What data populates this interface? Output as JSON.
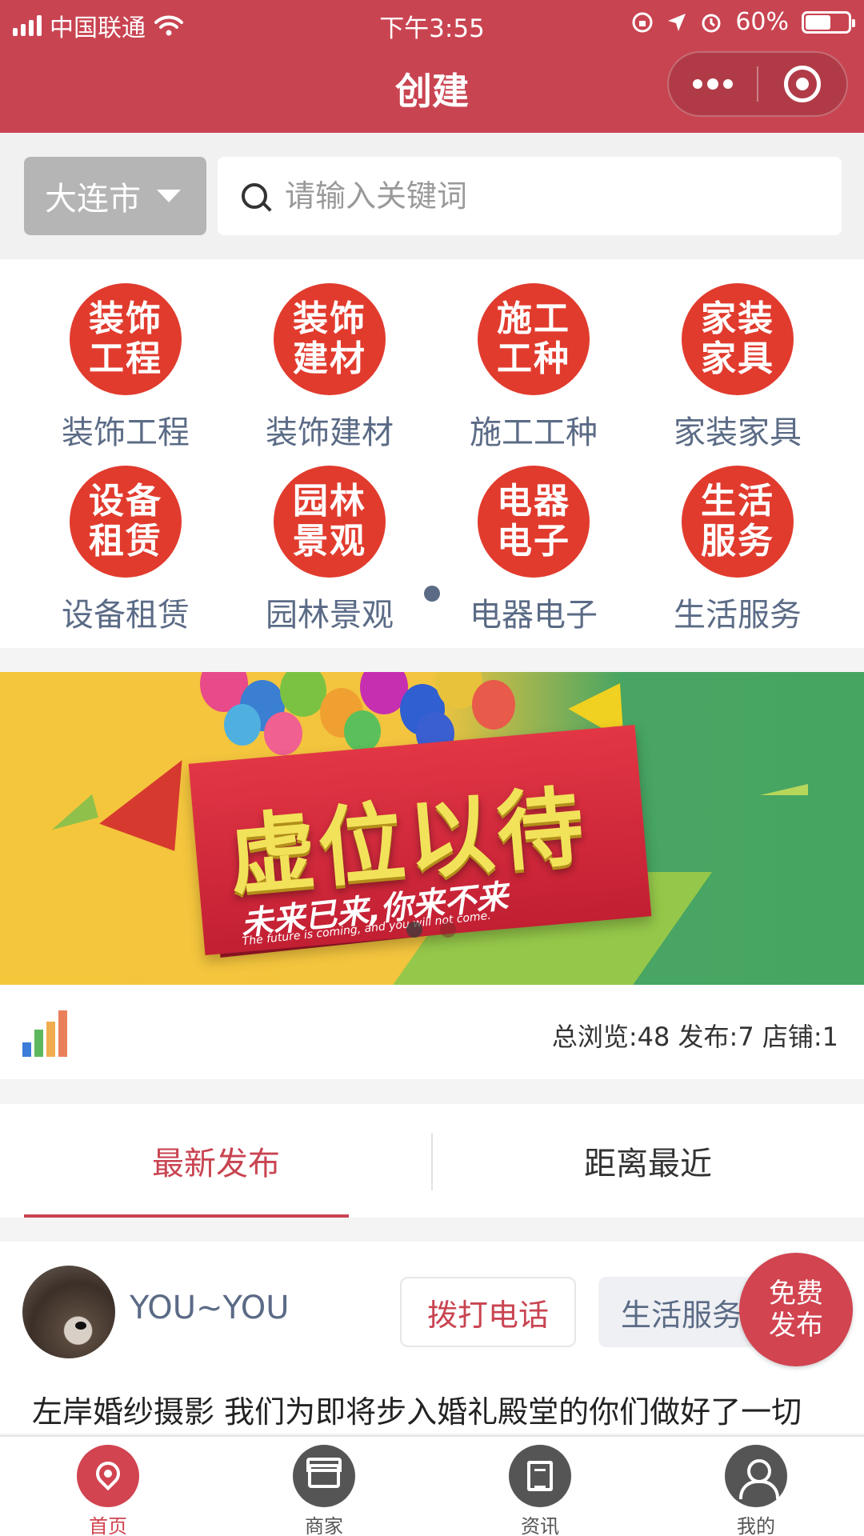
{
  "status_bar": {
    "carrier": "中国联通",
    "time": "下午3:55",
    "battery": "60%",
    "battery_level": 0.6
  },
  "nav": {
    "title": "创建"
  },
  "search": {
    "city": "大连市",
    "placeholder": "请输入关键词"
  },
  "categories": [
    {
      "badge_line1": "装饰",
      "badge_line2": "工程",
      "label": "装饰工程"
    },
    {
      "badge_line1": "装饰",
      "badge_line2": "建材",
      "label": "装饰建材"
    },
    {
      "badge_line1": "施工",
      "badge_line2": "工种",
      "label": "施工工种"
    },
    {
      "badge_line1": "家装",
      "badge_line2": "家具",
      "label": "家装家具"
    },
    {
      "badge_line1": "设备",
      "badge_line2": "租赁",
      "label": "设备租赁"
    },
    {
      "badge_line1": "园林",
      "badge_line2": "景观",
      "label": "园林景观"
    },
    {
      "badge_line1": "电器",
      "badge_line2": "电子",
      "label": "电器电子"
    },
    {
      "badge_line1": "生活",
      "badge_line2": "服务",
      "label": "生活服务"
    }
  ],
  "banner": {
    "headline": "虚位以待",
    "slogan": "未来已来,你来不来",
    "subtext": "The future is coming, and you will not come."
  },
  "stats": {
    "text": "总浏览:48 发布:7 店铺:1"
  },
  "tabs": [
    {
      "label": "最新发布",
      "active": true
    },
    {
      "label": "距离最近",
      "active": false
    }
  ],
  "post": {
    "username": "YOU~YOU",
    "call_label": "拨打电话",
    "category": "生活服务",
    "description": "左岸婚纱摄影 我们为即将步入婚礼殿堂的你们做好了一切"
  },
  "fab": {
    "line1": "免费",
    "line2": "发布"
  },
  "tabbar": [
    {
      "label": "首页",
      "icon": "location-pin-icon",
      "active": true
    },
    {
      "label": "商家",
      "icon": "shop-icon",
      "active": false
    },
    {
      "label": "资讯",
      "icon": "news-icon",
      "active": false
    },
    {
      "label": "我的",
      "icon": "user-icon",
      "active": false
    }
  ],
  "colors": {
    "brand": "#c94451",
    "badge_red": "#e13b2e",
    "link_blue": "#5b6b86"
  }
}
